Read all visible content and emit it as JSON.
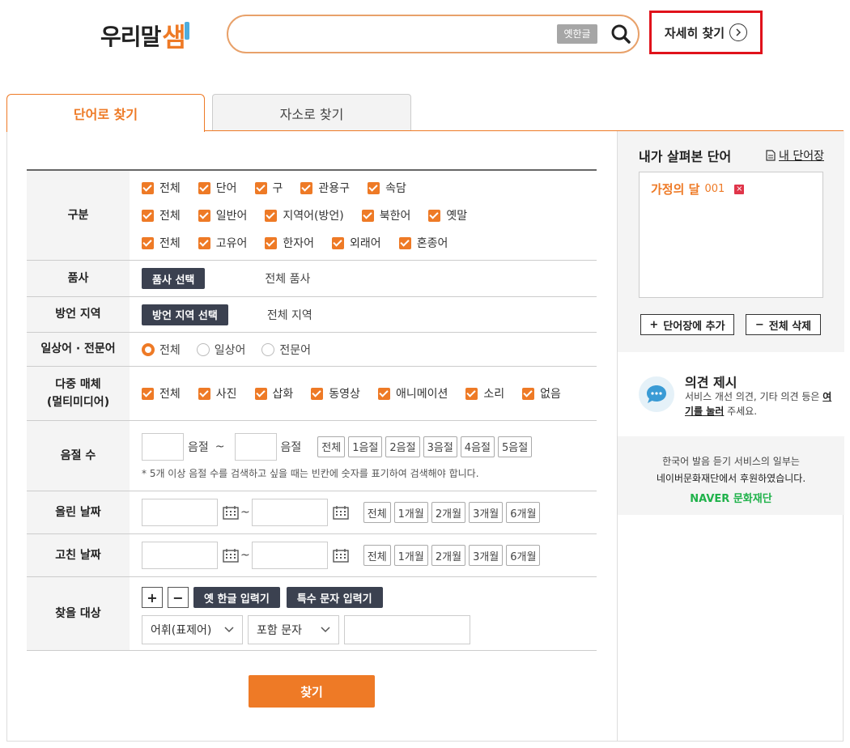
{
  "header": {
    "logo_main": "우리말",
    "logo_accent": "샘",
    "search_placeholder": "",
    "old_hangul_label": "옛한글",
    "detail_search_label": "자세히 찾기"
  },
  "tabs": [
    {
      "label": "단어로 찾기",
      "active": true
    },
    {
      "label": "자소로 찾기",
      "active": false
    }
  ],
  "form": {
    "category": {
      "label": "구분",
      "rows": [
        [
          "전체",
          "단어",
          "구",
          "관용구",
          "속담"
        ],
        [
          "전체",
          "일반어",
          "지역어(방언)",
          "북한어",
          "옛말"
        ],
        [
          "전체",
          "고유어",
          "한자어",
          "외래어",
          "혼종어"
        ]
      ]
    },
    "pos": {
      "label": "품사",
      "button": "품사 선택",
      "value": "전체 품사"
    },
    "region": {
      "label": "방언 지역",
      "button": "방언 지역 선택",
      "value": "전체 지역"
    },
    "field": {
      "label": "일상어 · 전문어",
      "options": [
        "전체",
        "일상어",
        "전문어"
      ],
      "selected": 0
    },
    "multimedia": {
      "label_line1": "다중 매체",
      "label_line2": "(멀티미디어)",
      "options": [
        "전체",
        "사진",
        "삽화",
        "동영상",
        "애니메이션",
        "소리",
        "없음"
      ]
    },
    "syllables": {
      "label": "음절 수",
      "unit": "음절",
      "tilde": "~",
      "quick": [
        "전체",
        "1음절",
        "2음절",
        "3음절",
        "4음절",
        "5음절"
      ],
      "note": "* 5개 이상 음절 수를 검색하고 싶을 때는 빈칸에 숫자를 표기하여 검색해야 합니다."
    },
    "uploaded": {
      "label": "올린 날짜",
      "tilde": "~",
      "quick": [
        "전체",
        "1개월",
        "2개월",
        "3개월",
        "6개월"
      ]
    },
    "modified": {
      "label": "고친 날짜",
      "tilde": "~",
      "quick": [
        "전체",
        "1개월",
        "2개월",
        "3개월",
        "6개월"
      ]
    },
    "target": {
      "label": "찾을 대상",
      "plus": "+",
      "minus": "−",
      "old_hangul_input": "옛 한글 입력기",
      "special_char_input": "특수 문자 입력기",
      "select1": "어휘(표제어)",
      "select2": "포함 문자"
    },
    "submit": "찾기"
  },
  "sidebar": {
    "recent_title": "내가 살펴본 단어",
    "my_words_link": "내 단어장",
    "recent_words": [
      {
        "word": "가정의 달",
        "num": "001"
      }
    ],
    "add_button": "단어장에 추가",
    "delete_all_button": "전체 삭제",
    "opinion_title": "의견 제시",
    "opinion_text_pre": "서비스 개선 의견, 기타 의견 등은 ",
    "opinion_link": "여기를 눌러",
    "opinion_text_post": " 주세요.",
    "sponsor_line1": "한국어 발음 듣기 서비스의 일부는",
    "sponsor_line2": "네이버문화재단에서 후원하였습니다.",
    "sponsor_logo": "NAVER 문화재단"
  },
  "colors": {
    "accent": "#ee7a26",
    "dark_button": "#3b4150",
    "highlight_border": "#e0121b",
    "naver_green": "#1fb24a"
  }
}
